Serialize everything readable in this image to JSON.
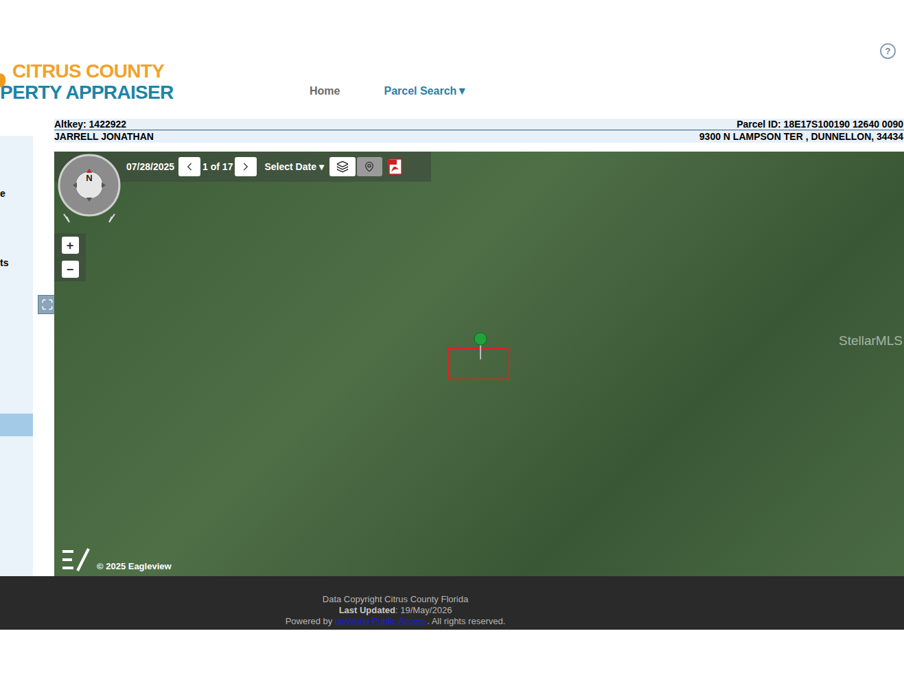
{
  "header": {
    "logo_top": "CITRUS COUNTY",
    "logo_bottom": "PERTY APPRAISER",
    "help": "?"
  },
  "nav": [
    {
      "label": "Home",
      "selected": false
    },
    {
      "label": "Parcel Search▼",
      "selected": true
    }
  ],
  "parcel": {
    "altkey": "Altkey: 1422922",
    "parcel_id": "Parcel ID: 18E17S100190 12640 0090",
    "owner": "JARRELL JONATHAN",
    "address": "9300 N LAMPSON TER , DUNNELLON, 34434"
  },
  "sidebar": {
    "items": [
      {
        "label": "e",
        "selected": false
      },
      {
        "label": "ts",
        "selected": false
      },
      {
        "label": "",
        "selected": true
      }
    ]
  },
  "map": {
    "compass": "N",
    "date": "07/28/2025",
    "page": "1 of 17",
    "select_date": "Select Date ▾",
    "zoom_in": "+",
    "zoom_out": "−",
    "watermark": "StellarMLS",
    "credit": "© 2025 Eagleview"
  },
  "footer": {
    "copyright": "Data Copyright Citrus County Florida",
    "updated_label": "Last Updated",
    "updated_value": ": 19/May/2026",
    "powered_prefix": "Powered by ",
    "powered_link": "iasWorld Public Access",
    "powered_suffix": ". All rights reserved."
  }
}
